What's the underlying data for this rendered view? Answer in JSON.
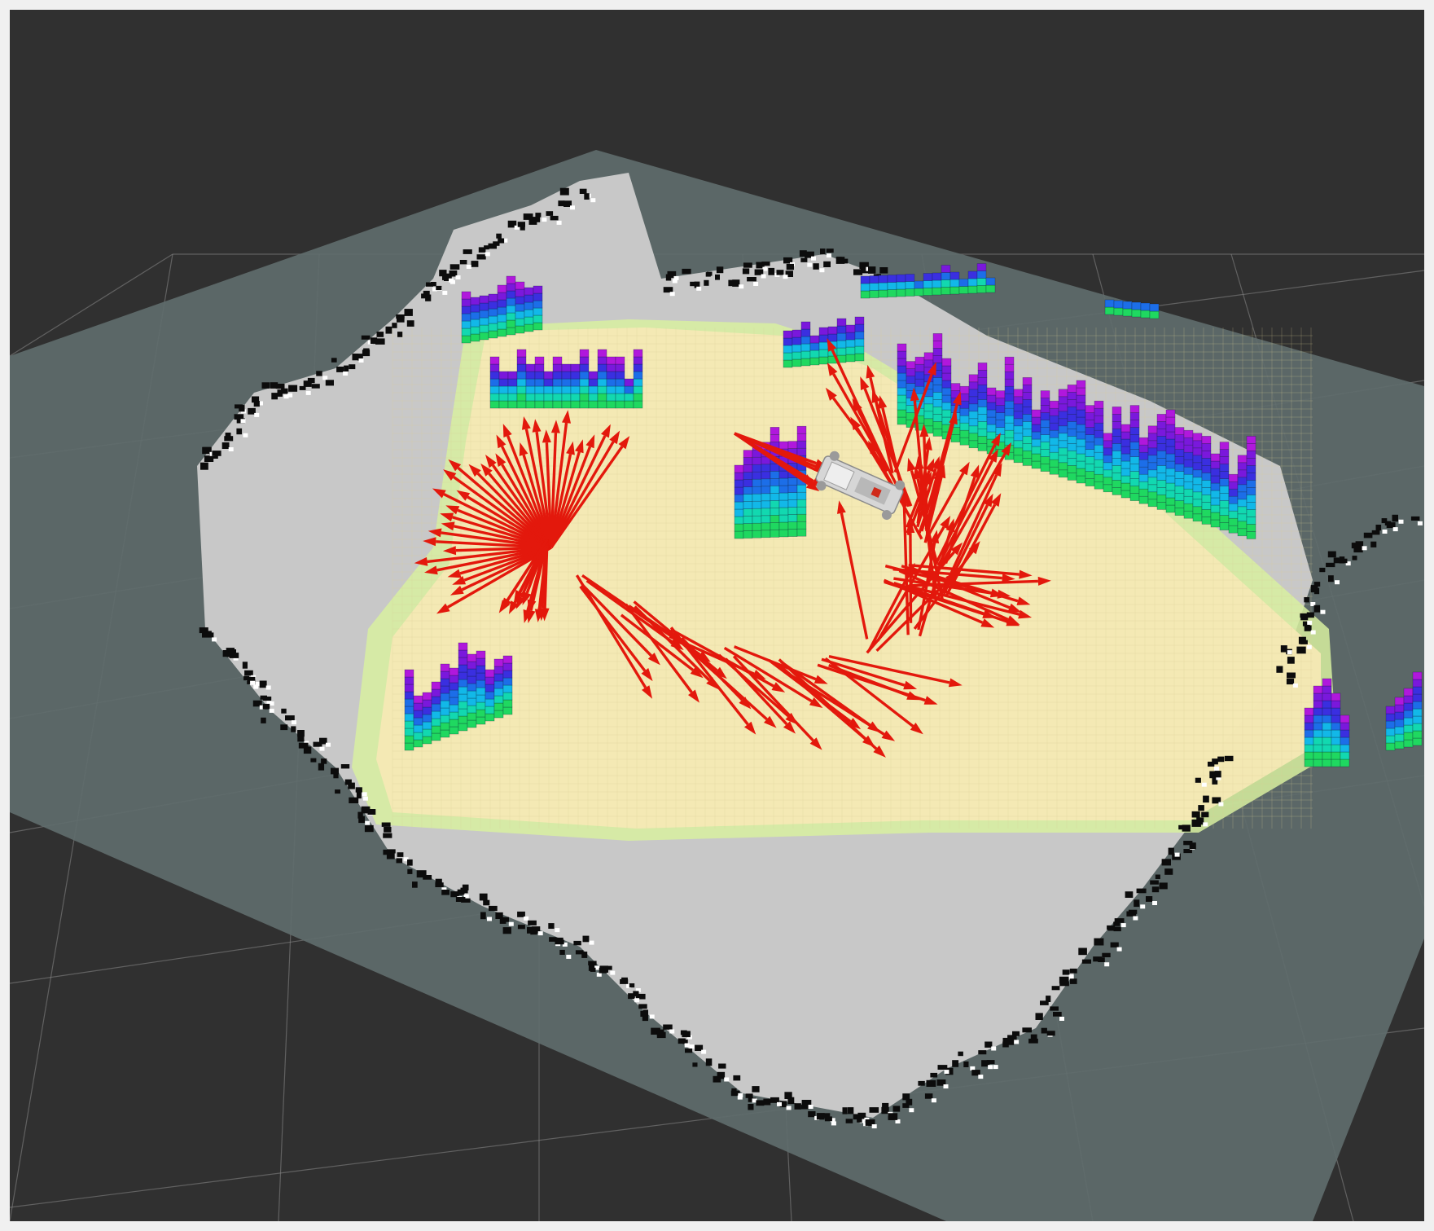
{
  "colors": {
    "frame": "#f0f0f0",
    "background": "#303030",
    "grid": "#8a8a8a",
    "map_unknown": "#5f6d6c",
    "map_free": "#c8c8c8",
    "map_occupied": "#0c0c0c",
    "costmap_low": "#f6e9b4",
    "costmap_edge": "#d8f0a0",
    "pose_arrow": "#e3180c",
    "robot": "#d6d6d6"
  },
  "icons": {
    "robot": "robot-model-icon",
    "pose": "pose-arrow-icon"
  },
  "layers": {
    "grid": {
      "visible": true
    },
    "occupancy_map": {
      "visible": true
    },
    "costmap": {
      "visible": true
    },
    "octomap_voxels": {
      "visible": true,
      "color_scheme": "height-rainbow"
    },
    "pose_array": {
      "visible": true,
      "count": 120
    },
    "robot_model": {
      "visible": true
    }
  }
}
